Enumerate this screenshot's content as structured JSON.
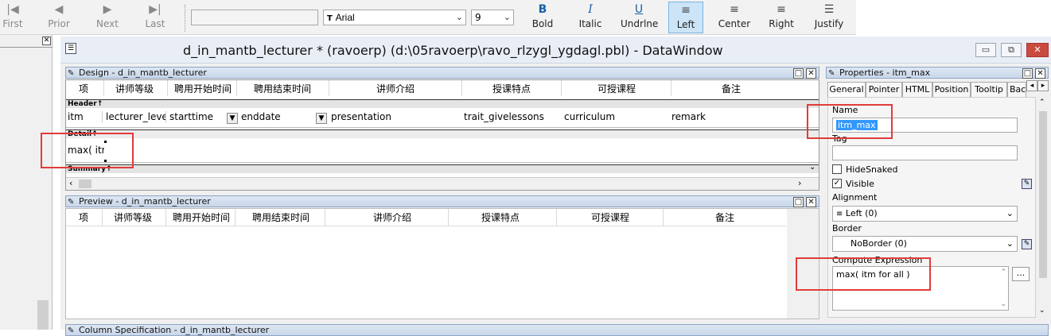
{
  "toolbar": {
    "first": "First",
    "prior": "Prior",
    "next": "Next",
    "last": "Last",
    "font_name": "Arial",
    "font_size": "9",
    "bold": "Bold",
    "italic": "Italic",
    "underline": "Undrlne",
    "left": "Left",
    "center": "Center",
    "right": "Right",
    "justify": "Justify"
  },
  "window": {
    "title": "d_in_mantb_lecturer * (ravoerp) (d:\\05ravoerp\\ravo_rlzygl_ygdagl.pbl) - DataWindow"
  },
  "design": {
    "title": "Design - d_in_mantb_lecturer",
    "header_labels": [
      "项",
      "讲师等级",
      "聘用开始时间",
      "聘用结束时间",
      "讲师介绍",
      "授课特点",
      "可授课程",
      "备注"
    ],
    "header_band": "Header↑",
    "columns": [
      "itm",
      "lecturer_level",
      "starttime",
      "enddate",
      "presentation",
      "trait_givelessons",
      "curriculum",
      "remark"
    ],
    "detail_band": "Detail↑",
    "computed": "max(  itm",
    "summary_band": "Summary↑"
  },
  "preview": {
    "title": "Preview - d_in_mantb_lecturer",
    "header_labels": [
      "项",
      "讲师等级",
      "聘用开始时间",
      "聘用结束时间",
      "讲师介绍",
      "授课特点",
      "可授课程",
      "备注"
    ]
  },
  "properties": {
    "title": "Properties - itm_max",
    "tabs": [
      "General",
      "Pointer",
      "HTML",
      "Position",
      "Tooltip",
      "Bac"
    ],
    "name_label": "Name",
    "name_value": "itm_max",
    "tag_label": "Tag",
    "tag_value": "",
    "hidesnaked": "HideSnaked",
    "visible": "Visible",
    "alignment_label": "Alignment",
    "alignment_value": "Left (0)",
    "border_label": "Border",
    "border_value": "NoBorder (0)",
    "compute_label": "Compute Expression",
    "compute_value": "max(  itm  for all )",
    "ellipsis": "..."
  },
  "column_spec": {
    "title": "Column Specification - d_in_mantb_lecturer"
  },
  "colors": {
    "highlight_red": "#e23b3b",
    "selection_blue": "#3399ff"
  }
}
